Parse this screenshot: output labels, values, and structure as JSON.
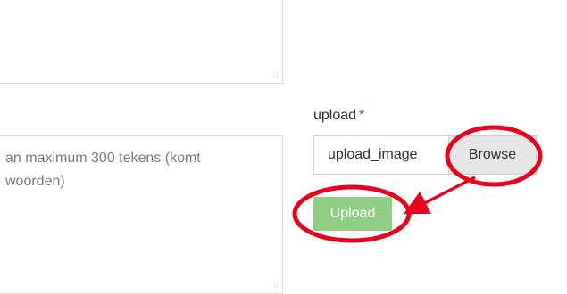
{
  "top_textarea": {
    "value": ""
  },
  "description_textarea": {
    "value": "an maximum 300 tekens (komt\n woorden)"
  },
  "upload": {
    "label": "upload",
    "required_mark": "*",
    "file_name": "upload_image",
    "browse_label": "Browse",
    "upload_label": "Upload"
  },
  "annotation": {
    "color": "#e8001c",
    "highlights": [
      "browse-button",
      "upload-button"
    ]
  },
  "colors": {
    "upload_button_bg": "#8fcf84",
    "browse_button_bg": "#e6e6e6",
    "required_mark": "#2e6da4"
  }
}
